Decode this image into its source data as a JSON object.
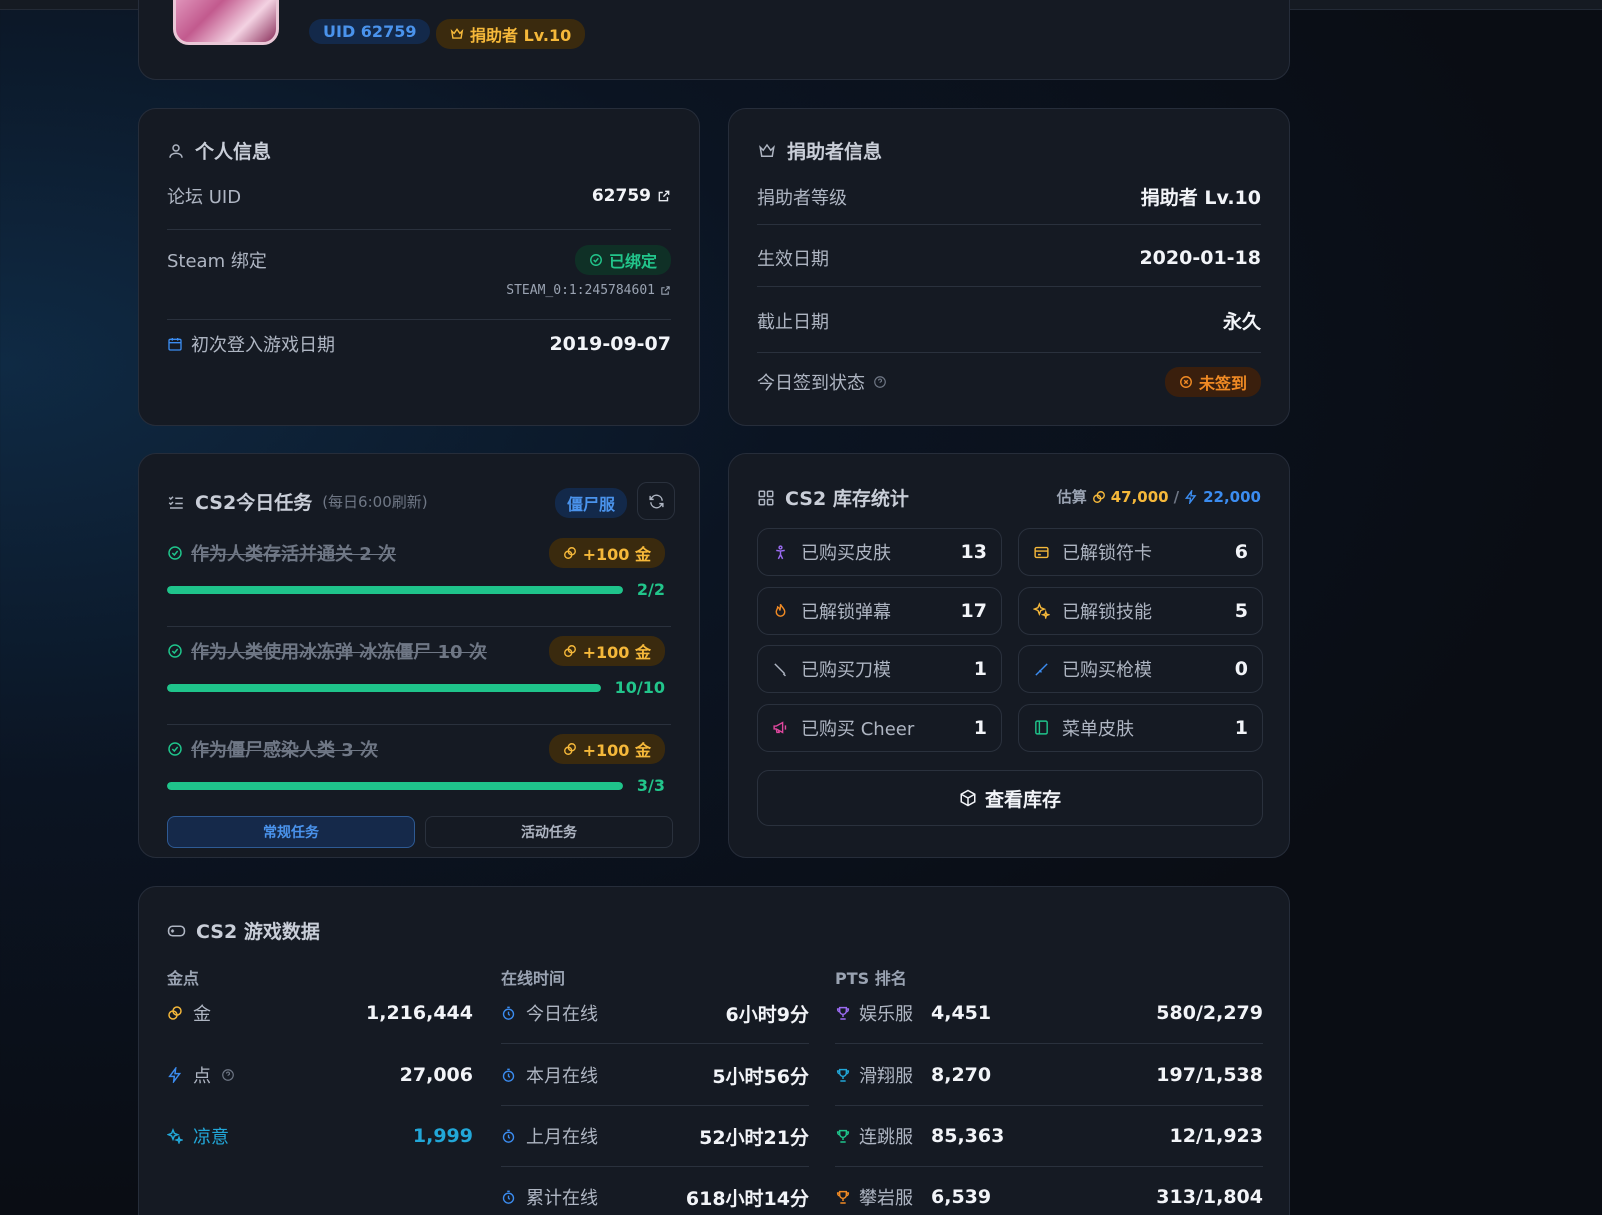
{
  "header": {
    "uid_badge": "UID 62759",
    "donor_badge": "捐助者 Lv.10"
  },
  "personal": {
    "title": "个人信息",
    "forum_uid_label": "论坛 UID",
    "forum_uid_value": "62759",
    "steam_label": "Steam 绑定",
    "steam_status": "已绑定",
    "steam_id": "STEAM_0:1:245784601",
    "first_login_label": "初次登入游戏日期",
    "first_login_value": "2019-09-07"
  },
  "donor": {
    "title": "捐助者信息",
    "level_label": "捐助者等级",
    "level_value": "捐助者 Lv.10",
    "start_label": "生效日期",
    "start_value": "2020-01-18",
    "end_label": "截止日期",
    "end_value": "永久",
    "checkin_label": "今日签到状态",
    "checkin_value": "未签到"
  },
  "tasks": {
    "title": "CS2今日任务",
    "subtitle": "(每日6:00刷新)",
    "server_badge": "僵尸服",
    "items": [
      {
        "name": "作为人类存活并通关 2 次",
        "reward": "+100 金",
        "progress_text": "2/2",
        "progress": 1.0
      },
      {
        "name": "作为人类使用冰冻弹 冰冻僵尸 10 次",
        "reward": "+100 金",
        "progress_text": "10/10",
        "progress": 1.0
      },
      {
        "name": "作为僵尸感染人类 3 次",
        "reward": "+100 金",
        "progress_text": "3/3",
        "progress": 1.0
      }
    ],
    "tab_regular": "常规任务",
    "tab_event": "活动任务"
  },
  "inventory": {
    "title": "CS2 库存统计",
    "estimate_label": "估算",
    "estimate_gold": "47,000",
    "separator": "/",
    "estimate_points": "22,000",
    "tiles": [
      {
        "label": "已购买皮肤",
        "value": "13"
      },
      {
        "label": "已解锁符卡",
        "value": "6"
      },
      {
        "label": "已解锁弹幕",
        "value": "17"
      },
      {
        "label": "已解锁技能",
        "value": "5"
      },
      {
        "label": "已购买刀模",
        "value": "1"
      },
      {
        "label": "已购买枪模",
        "value": "0"
      },
      {
        "label": "已购买 Cheer",
        "value": "1"
      },
      {
        "label": "菜单皮肤",
        "value": "1"
      }
    ],
    "view_button": "查看库存"
  },
  "game": {
    "title": "CS2 游戏数据",
    "col1_head": "金点",
    "col2_head": "在线时间",
    "col3_head": "PTS 排名",
    "currency": [
      {
        "label": "金",
        "value": "1,216,444"
      },
      {
        "label": "点",
        "value": "27,006"
      },
      {
        "label": "凉意",
        "value": "1,999"
      }
    ],
    "online": [
      {
        "label": "今日在线",
        "value": "6小时9分"
      },
      {
        "label": "本月在线",
        "value": "5小时56分"
      },
      {
        "label": "上月在线",
        "value": "52小时21分"
      },
      {
        "label": "累计在线",
        "value": "618小时14分"
      }
    ],
    "pts": [
      {
        "server": "娱乐服",
        "pts": "4,451",
        "rank": "580/2,279"
      },
      {
        "server": "滑翔服",
        "pts": "8,270",
        "rank": "197/1,538"
      },
      {
        "server": "连跳服",
        "pts": "85,363",
        "rank": "12/1,923"
      },
      {
        "server": "攀岩服",
        "pts": "6,539",
        "rank": "313/1,804"
      }
    ]
  },
  "colors": {
    "accent_green": "#1fc48b",
    "gold": "#f5b83a",
    "blue": "#3b8cf0",
    "orange": "#f08a24",
    "purple": "#9b6bf2",
    "cyan": "#22a7d8",
    "teal": "#1fc48b",
    "amber": "#f08a24"
  }
}
